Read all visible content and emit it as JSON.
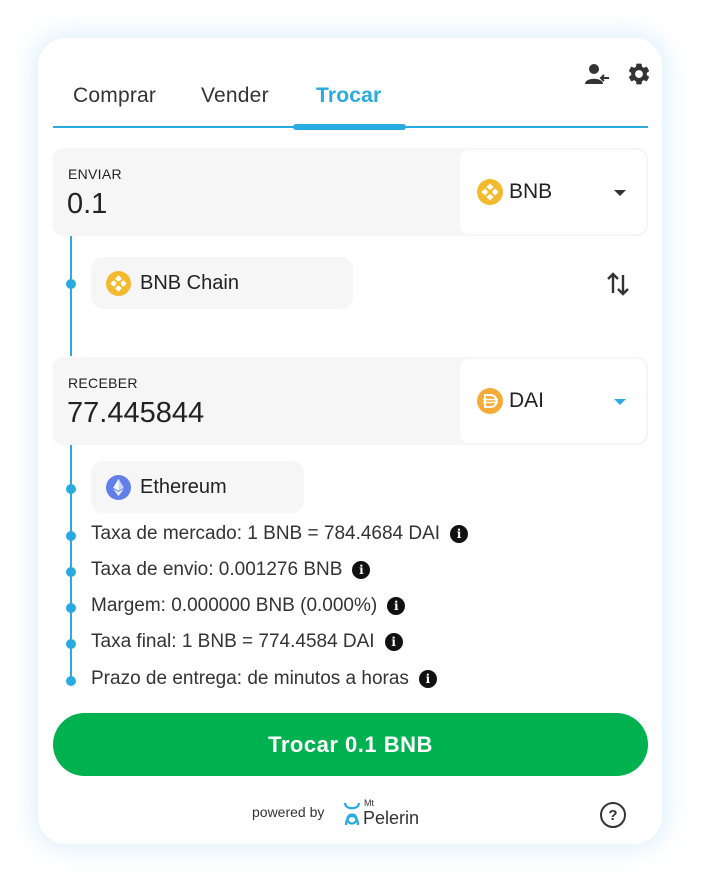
{
  "tabs": [
    {
      "label": "Comprar",
      "active": false
    },
    {
      "label": "Vender",
      "active": false
    },
    {
      "label": "Trocar",
      "active": true
    }
  ],
  "header_icons": [
    "account-switch-icon",
    "gear-icon"
  ],
  "send": {
    "label": "ENVIAR",
    "amount": "0.1",
    "token": "BNB",
    "token_icon": "bnb-icon",
    "network": "BNB Chain",
    "network_icon": "bnb-chain-icon"
  },
  "receive": {
    "label": "RECEBER",
    "amount": "77.445844",
    "token": "DAI",
    "token_icon": "dai-icon",
    "network": "Ethereum",
    "network_icon": "ethereum-icon"
  },
  "details": [
    "Taxa de mercado: 1 BNB = 784.4684 DAI",
    "Taxa de envio: 0.001276 BNB",
    "Margem: 0.000000 BNB (0.000%)",
    "Taxa final: 1 BNB = 774.4584 DAI",
    "Prazo de entrega: de minutos a horas"
  ],
  "action_button": "Trocar 0.1 BNB",
  "footer": {
    "powered_by": "powered by",
    "brand_small": "Mt",
    "brand_name": "Pelerin",
    "help": "?"
  },
  "colors": {
    "accent": "#29abe2",
    "button": "#00b14f",
    "bnb": "#f3ba2f",
    "dai": "#f5ac37",
    "eth": "#627eea"
  }
}
